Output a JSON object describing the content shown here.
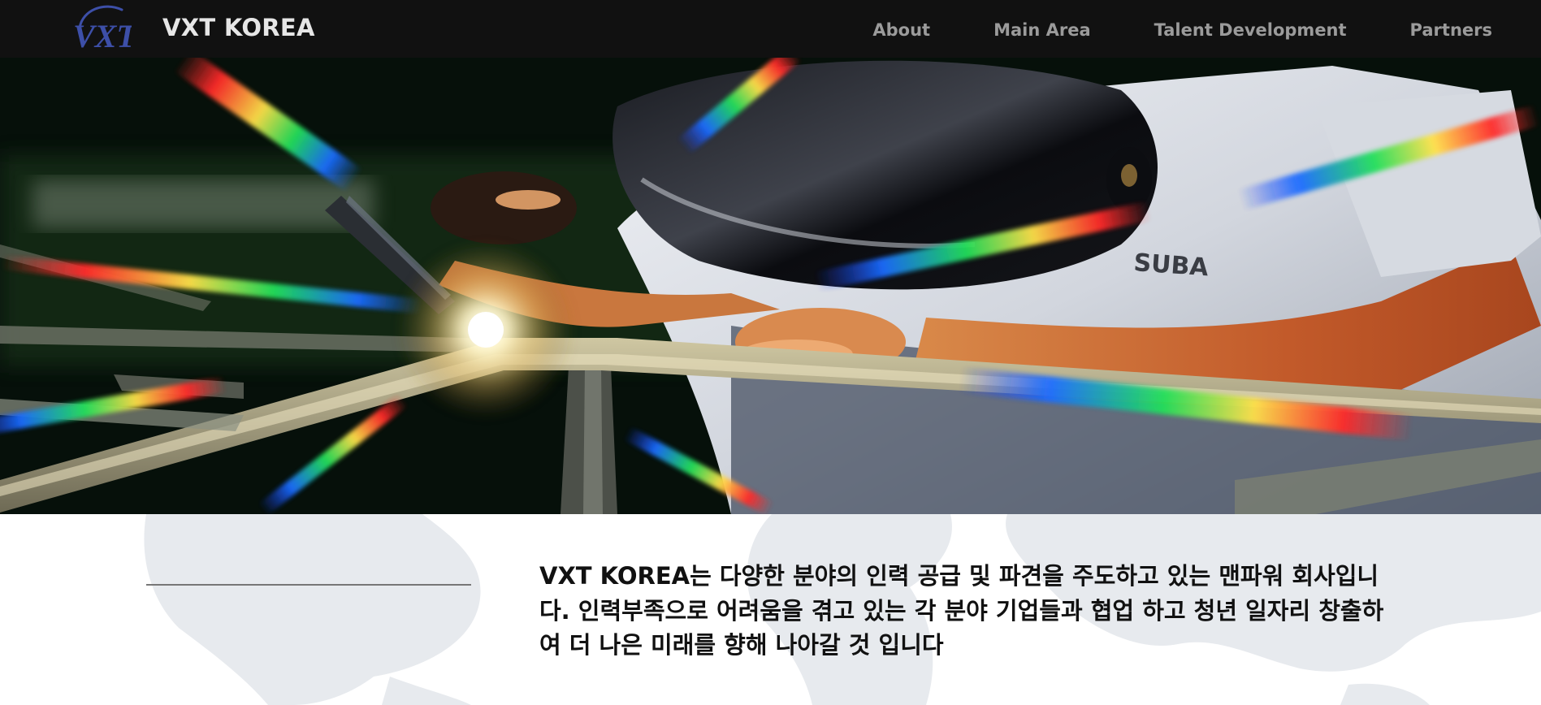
{
  "header": {
    "brand": "VXT KOREA",
    "logo_text": "VXT",
    "nav": [
      {
        "label": "About"
      },
      {
        "label": "Main Area"
      },
      {
        "label": "Talent Development"
      },
      {
        "label": "Partners"
      }
    ]
  },
  "hero": {
    "image": "welder-with-prism-light-icon",
    "shirt_text": "SUBA"
  },
  "intro": {
    "text": "VXT KOREA는 다양한 분야의 인력 공급 및 파견을 주도하고 있는 맨파워 회사입니다. 인력부족으로 어려움을 겪고 있는 각 분야 기업들과 협업 하고 청년 일자리 창출하여 더 나은 미래를 향해 나아갈 것 입니다",
    "background": "world-map-icon"
  },
  "colors": {
    "header_bg": "#111111",
    "brand": "#e6e6e6",
    "nav": "#9b9b9b",
    "logo": "#3d4fa8",
    "body_text": "#111111",
    "map": "#e7eaee"
  }
}
